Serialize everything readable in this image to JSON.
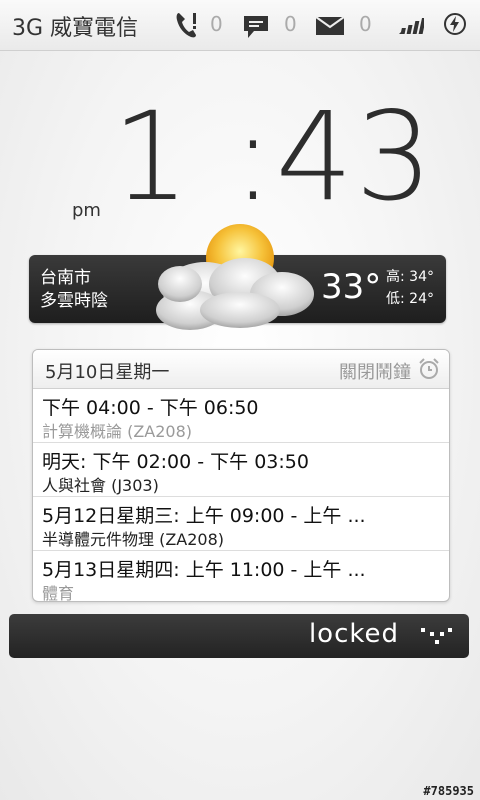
{
  "status_bar": {
    "carrier": "3G 威寶電信",
    "missed_calls": "0",
    "messages": "0",
    "emails": "0"
  },
  "clock": {
    "time": "1 :43",
    "ampm": "pm"
  },
  "weather": {
    "city": "台南市",
    "condition": "多雲時陰",
    "temp": "33°",
    "high": "高: 34°",
    "low": "低: 24°"
  },
  "calendar": {
    "date": "5月10日星期一",
    "alarm_status": "關閉鬧鐘",
    "events": [
      {
        "time": "下午 04:00 - 下午 06:50",
        "title": "計算機概論 (ZA208)",
        "title_color": "#9a9a9a"
      },
      {
        "time": "明天: 下午 02:00 - 下午 03:50",
        "title": "人與社會 (J303)",
        "title_color": "#222222"
      },
      {
        "time": "5月12日星期三: 上午 09:00 - 上午 ...",
        "title": "半導體元件物理 (ZA208)",
        "title_color": "#222222"
      },
      {
        "time": "5月13日星期四: 上午 11:00 - 上午 ...",
        "title": "體育",
        "title_color": "#9a9a9a"
      }
    ]
  },
  "lock": {
    "label": "locked"
  },
  "watermark": "#785935"
}
